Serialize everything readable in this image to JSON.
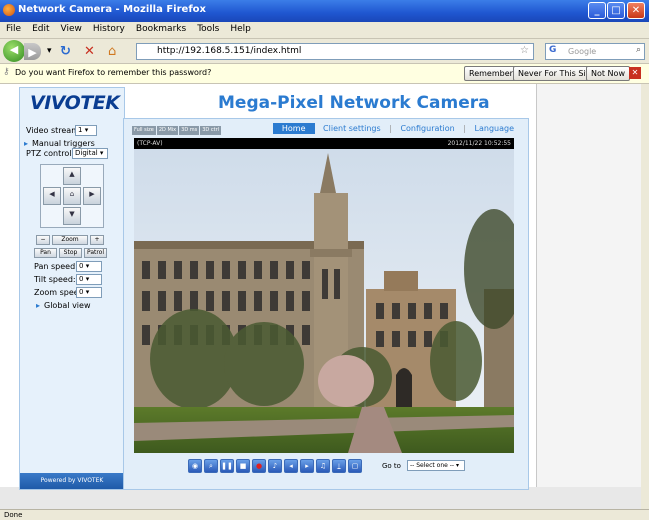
{
  "window": {
    "title": "Network Camera - Mozilla Firefox"
  },
  "menu": [
    "File",
    "Edit",
    "View",
    "History",
    "Bookmarks",
    "Tools",
    "Help"
  ],
  "nav": {
    "url": "http://192.168.5.151/index.html",
    "search_placeholder": "Google"
  },
  "password_bar": {
    "message": "Do you want Firefox to remember this password?",
    "remember": "Remember",
    "never": "Never For This Site",
    "not_now": "Not Now"
  },
  "left": {
    "logo": "VIVOTEK",
    "video_stream_label": "Video stream:",
    "video_stream_value": "1",
    "manual_triggers": "Manual triggers",
    "ptz_label": "PTZ control",
    "ptz_value": "Digital",
    "zoom_label": "Zoom",
    "pan_btn": "Pan",
    "stop_btn": "Stop",
    "patrol_btn": "Patrol",
    "pan_speed_label": "Pan speed:",
    "pan_speed": "0",
    "tilt_speed_label": "Tilt speed:",
    "tilt_speed": "0",
    "zoom_speed_label": "Zoom speed:",
    "zoom_speed": "0",
    "global_view": "Global view",
    "footer": "Powered by VIVOTEK"
  },
  "main": {
    "title": "Mega-Pixel Network Camera",
    "stream_tabs": [
      "Full size",
      "2D Mix",
      "3D ms",
      "3D ctrl"
    ],
    "links": [
      "Home",
      "Client settings",
      "Configuration",
      "Language"
    ],
    "cam_left": "(TCP-AV)",
    "cam_right": "2012/11/22 10:52:55",
    "goto_label": "Go to",
    "goto_value": "-- Select one --"
  },
  "status": "Done"
}
